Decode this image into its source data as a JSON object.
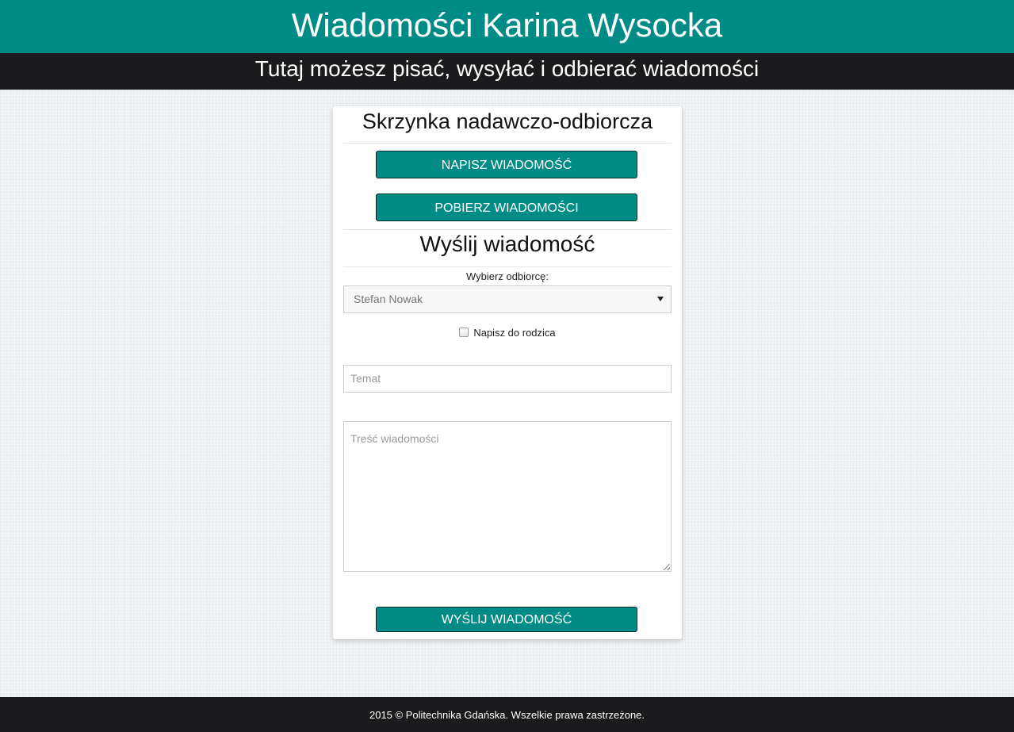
{
  "header": {
    "title": "Wiadomości Karina Wysocka",
    "subtitle": "Tutaj możesz pisać, wysyłać i odbierać wiadomości"
  },
  "panel": {
    "title": "Skrzynka nadawczo-odbiorcza",
    "write_button": "NAPISZ WIADOMOŚĆ",
    "fetch_button": "POBIERZ WIADOMOŚCI"
  },
  "compose": {
    "title": "Wyślij wiadomość",
    "recipient_label": "Wybierz odbiorcę:",
    "recipient_value": "Stefan Nowak",
    "parent_checkbox_label": "Napisz do rodzica",
    "parent_checkbox_checked": false,
    "subject_placeholder": "Temat",
    "subject_value": "",
    "body_placeholder": "Treść wiadomości",
    "body_value": "",
    "send_button": "WYŚLIJ WIADOMOŚĆ"
  },
  "footer": {
    "text": "2015 © Politechnika Gdańska. Wszelkie prawa zastrzeżone."
  },
  "colors": {
    "accent": "#008b87",
    "dark": "#1b1b1d",
    "background": "#f1f3f4"
  }
}
